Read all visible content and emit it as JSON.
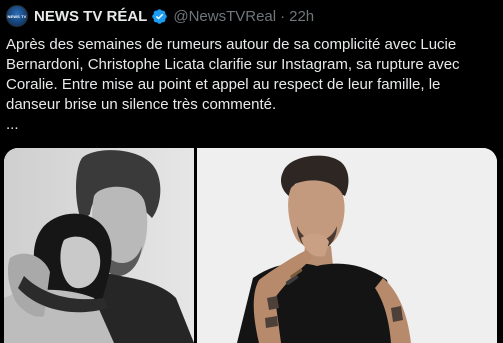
{
  "post": {
    "author_name": "NEWS TV RÉAL",
    "avatar_text": "NEWS TV",
    "handle": "@NewsTVReal",
    "separator": "·",
    "timestamp": "22h",
    "body": "Après des semaines de rumeurs autour de sa complicité avec Lucie Bernardoni, Christophe Licata clarifie sur Instagram, sa rupture avec Coralie. Entre mise au point et appel au respect de leur famille, le danseur brise un silence très commenté.",
    "ellipsis": "...",
    "verified_color": "#1d9bf0"
  },
  "media": {
    "left_icon": "photo-couple-black-white",
    "right_icon": "photo-man-black-tshirt"
  }
}
